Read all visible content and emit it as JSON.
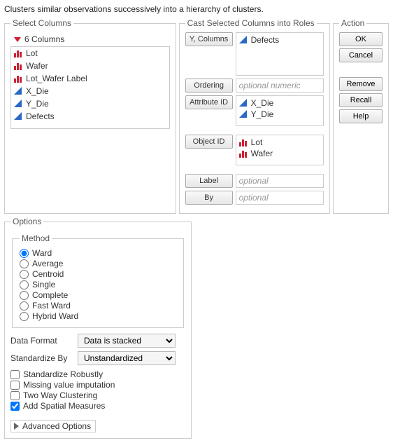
{
  "description": "Clusters similar observations successively into a hierarchy of clusters.",
  "selectColumns": {
    "legend": "Select Columns",
    "headerCount": "6 Columns",
    "items": [
      {
        "name": "Lot",
        "icon": "red-bars"
      },
      {
        "name": "Wafer",
        "icon": "red-bars"
      },
      {
        "name": "Lot_Wafer Label",
        "icon": "red-bars"
      },
      {
        "name": "X_Die",
        "icon": "blue-tri"
      },
      {
        "name": "Y_Die",
        "icon": "blue-tri"
      },
      {
        "name": "Defects",
        "icon": "blue-tri"
      }
    ]
  },
  "options": {
    "legend": "Options",
    "methodLegend": "Method",
    "methods": [
      "Ward",
      "Average",
      "Centroid",
      "Single",
      "Complete",
      "Fast Ward",
      "Hybrid Ward"
    ],
    "methodSelected": "Ward",
    "dataFormatLabel": "Data Format",
    "dataFormatValue": "Data is stacked",
    "standardizeByLabel": "Standardize By",
    "standardizeByValue": "Unstandardized",
    "checks": [
      {
        "label": "Standardize Robustly",
        "checked": false
      },
      {
        "label": "Missing value imputation",
        "checked": false
      },
      {
        "label": "Two Way Clustering",
        "checked": false
      },
      {
        "label": "Add Spatial Measures",
        "checked": true
      }
    ],
    "advancedLabel": "Advanced Options"
  },
  "cast": {
    "legend": "Cast Selected Columns into Roles",
    "roles": [
      {
        "btn": "Y, Columns",
        "items": [
          {
            "name": "Defects",
            "icon": "blue-tri"
          }
        ],
        "placeholder": "",
        "height": "tall"
      },
      {
        "btn": "Ordering",
        "items": [],
        "placeholder": "optional numeric",
        "height": ""
      },
      {
        "btn": "Attribute ID",
        "items": [
          {
            "name": "X_Die",
            "icon": "blue-tri"
          },
          {
            "name": "Y_Die",
            "icon": "blue-tri"
          }
        ],
        "placeholder": "",
        "height": "med"
      },
      {
        "btn": "Object ID",
        "items": [
          {
            "name": "Lot",
            "icon": "red-bars"
          },
          {
            "name": "Wafer",
            "icon": "red-bars"
          }
        ],
        "placeholder": "",
        "height": "med"
      },
      {
        "btn": "Label",
        "items": [],
        "placeholder": "optional",
        "height": ""
      },
      {
        "btn": "By",
        "items": [],
        "placeholder": "optional",
        "height": ""
      }
    ]
  },
  "actions": {
    "legend": "Action",
    "ok": "OK",
    "cancel": "Cancel",
    "remove": "Remove",
    "recall": "Recall",
    "help": "Help"
  }
}
